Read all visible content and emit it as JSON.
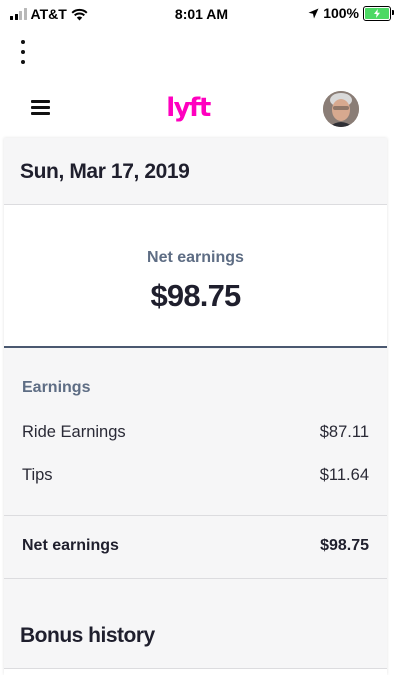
{
  "status_bar": {
    "carrier": "AT&T",
    "time": "8:01 AM",
    "battery": "100%"
  },
  "header": {
    "logo_text": "lyft",
    "brand_color": "#ff00bf"
  },
  "date": "Sun, Mar 17, 2019",
  "summary": {
    "label": "Net earnings",
    "amount": "$98.75"
  },
  "earnings": {
    "title": "Earnings",
    "items": [
      {
        "label": "Ride Earnings",
        "value": "$87.11"
      },
      {
        "label": "Tips",
        "value": "$11.64"
      }
    ]
  },
  "total": {
    "label": "Net earnings",
    "value": "$98.75"
  },
  "bonus": {
    "title": "Bonus history"
  },
  "icons": {
    "menu": "hamburger-menu-icon",
    "more": "more-vertical-icon",
    "location": "location-arrow-icon",
    "wifi": "wifi-icon",
    "battery": "battery-charging-icon"
  }
}
